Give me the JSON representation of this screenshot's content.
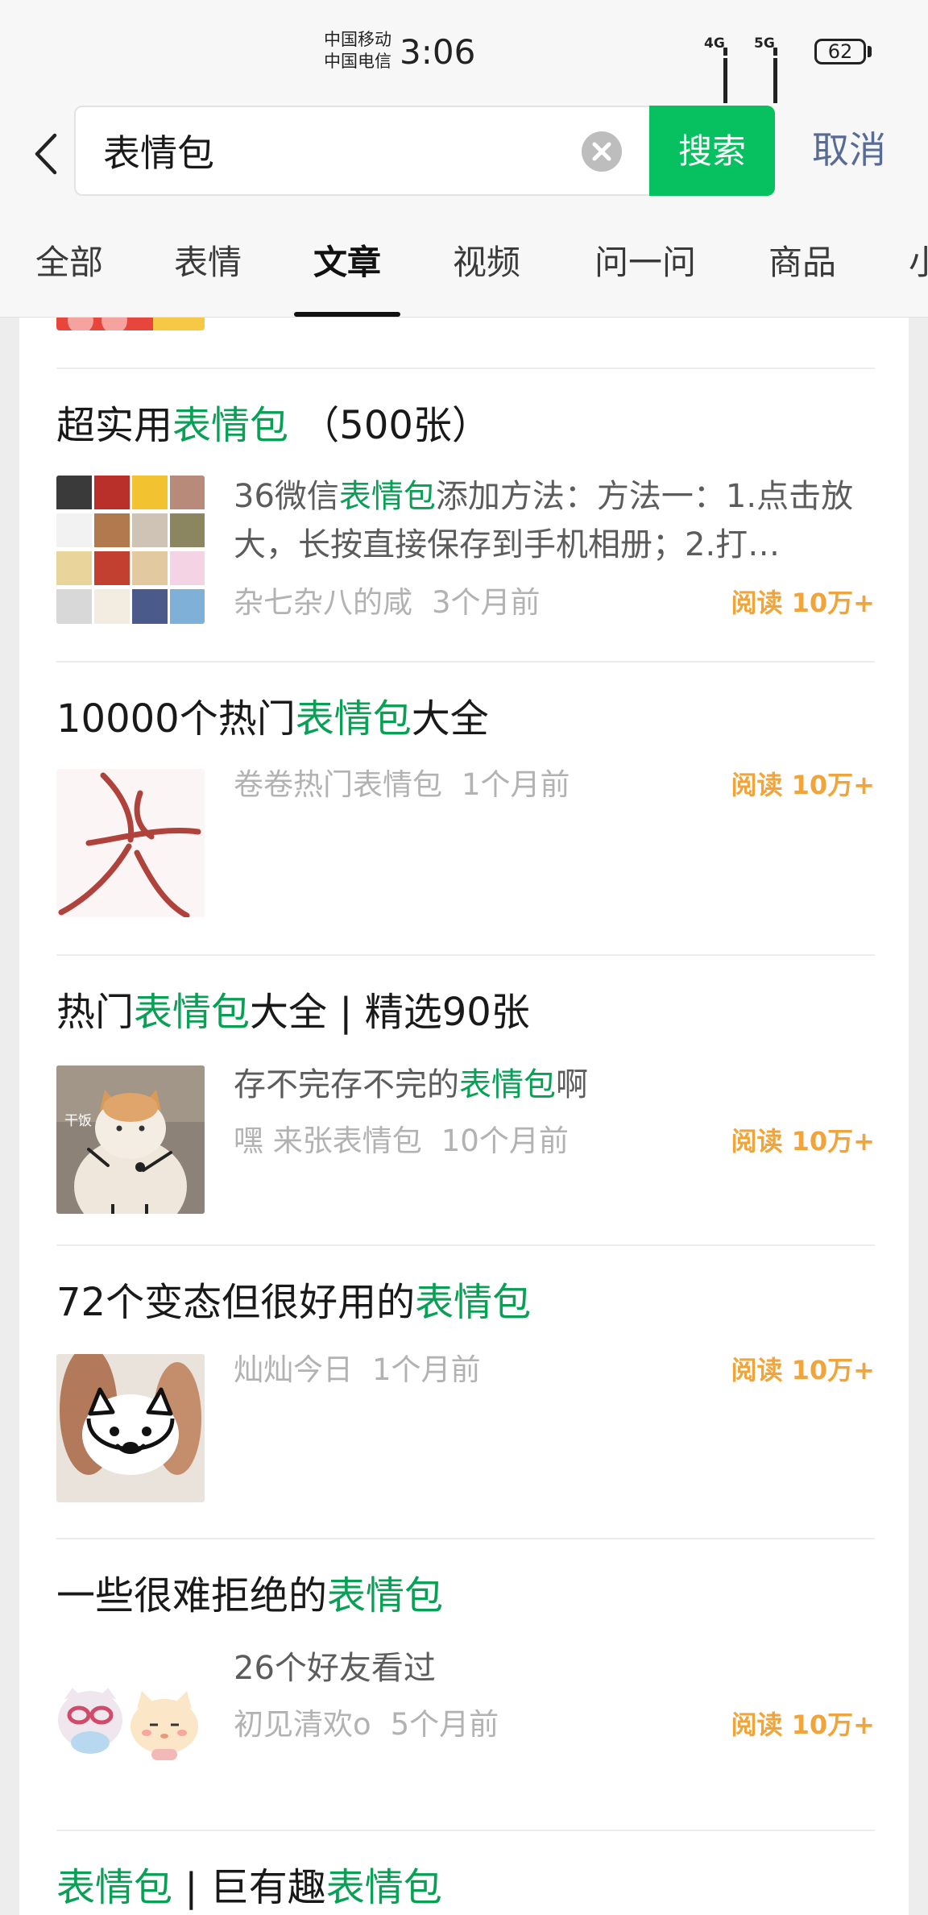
{
  "status_bar": {
    "carrier_1": "中国移动",
    "carrier_2": "中国电信",
    "time": "3:06",
    "net_1": "4G",
    "net_2": "5G",
    "battery": "62"
  },
  "search": {
    "query": "表情包",
    "button_label": "搜索",
    "cancel_label": "取消"
  },
  "tabs": [
    {
      "label": "全部"
    },
    {
      "label": "表情"
    },
    {
      "label": "文章",
      "active": true
    },
    {
      "label": "视频"
    },
    {
      "label": "问一问"
    },
    {
      "label": "商品"
    },
    {
      "label": "小"
    }
  ],
  "results": [
    {
      "title_parts": [
        "超实用",
        "表情包",
        " （500张）"
      ],
      "snippet_parts": [
        "36微信",
        "表情包",
        "添加方法：方法一：1.点击放大，长按直接保存到手机相册；2.打…"
      ],
      "source": "杂七杂八的咸",
      "time": "3个月前",
      "reads": "阅读 10万+"
    },
    {
      "title_parts": [
        "10000个热门",
        "表情包",
        "大全"
      ],
      "source": "卷卷热门表情包",
      "time": "1个月前",
      "reads": "阅读 10万+"
    },
    {
      "title_parts": [
        "热门",
        "表情包",
        "大全 | 精选90张"
      ],
      "snippet_parts": [
        "存不完存不完的",
        "表情包",
        "啊"
      ],
      "thumb_caption": "干饭",
      "source": "嘿 来张表情包",
      "time": "10个月前",
      "reads": "阅读 10万+"
    },
    {
      "title_parts": [
        "72个变态但很好用的",
        "表情包"
      ],
      "source": "灿灿今日",
      "time": "1个月前",
      "reads": "阅读 10万+"
    },
    {
      "title_parts": [
        "一些很难拒绝的",
        "表情包"
      ],
      "snippet_parts": [
        "26个好友看过"
      ],
      "source": "初见清欢o",
      "time": "5个月前",
      "reads": "阅读 10万+"
    },
    {
      "title_parts": [
        "表情包",
        " | 巨有趣",
        "表情包"
      ]
    }
  ],
  "colors": {
    "accent_green": "#07c160",
    "highlight_green": "#07a055",
    "cancel_blue": "#576b95",
    "read_orange": "#f0a43a"
  }
}
